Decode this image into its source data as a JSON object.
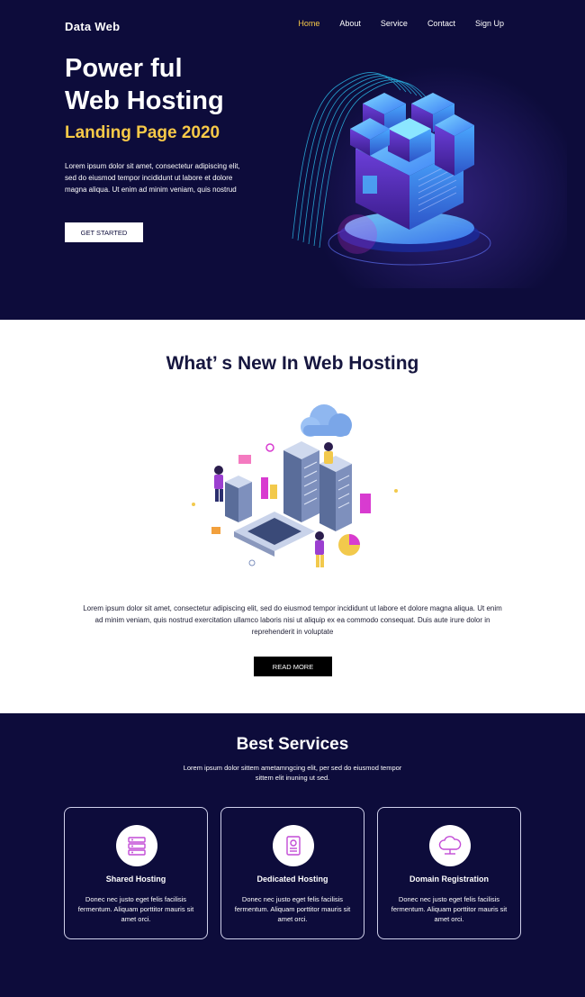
{
  "header": {
    "logo": "Data Web",
    "nav": [
      "Home",
      "About",
      "Service",
      "Contact",
      "Sign Up"
    ],
    "active_nav": "Home"
  },
  "hero": {
    "title_line1": "Power ful",
    "title_line2": "Web Hosting",
    "subtitle": "Landing Page 2020",
    "text": "Lorem ipsum dolor sit amet, consectetur adipiscing elit, sed do eiusmod tempor incididunt ut labore et dolore magna aliqua. Ut enim ad minim veniam, quis nostrud",
    "button": "GET STARTED"
  },
  "whats_new": {
    "title": "What’ s New In Web Hosting",
    "text": "Lorem ipsum dolor sit amet, consectetur adipiscing elit, sed do eiusmod tempor incididunt ut labore et dolore magna aliqua. Ut enim ad minim veniam, quis nostrud exercitation ullamco laboris nisi ut aliquip ex ea commodo consequat. Duis aute irure dolor in reprehenderit in voluptate",
    "button": "READ MORE"
  },
  "services": {
    "title": "Best Services",
    "text": "Lorem ipsum dolor sittem ametamngcing elit, per sed do eiusmod tempor sittem elit inuning ut sed.",
    "cards": [
      {
        "title": "Shared Hosting",
        "desc": "Donec nec justo eget felis facilisis fermentum. Aliquam porttitor mauris sit amet orci.",
        "icon": "server-stack-icon"
      },
      {
        "title": "Dedicated Hosting",
        "desc": "Donec nec justo eget felis facilisis fermentum. Aliquam porttitor mauris sit amet orci.",
        "icon": "dedicated-server-icon"
      },
      {
        "title": "Domain Registration",
        "desc": "Donec nec justo eget felis facilisis fermentum. Aliquam porttitor mauris sit amet orci.",
        "icon": "cloud-domain-icon"
      }
    ]
  },
  "colors": {
    "navy": "#0d0c3b",
    "accent_yellow": "#f7c948",
    "icon_purple": "#c24bd6"
  }
}
